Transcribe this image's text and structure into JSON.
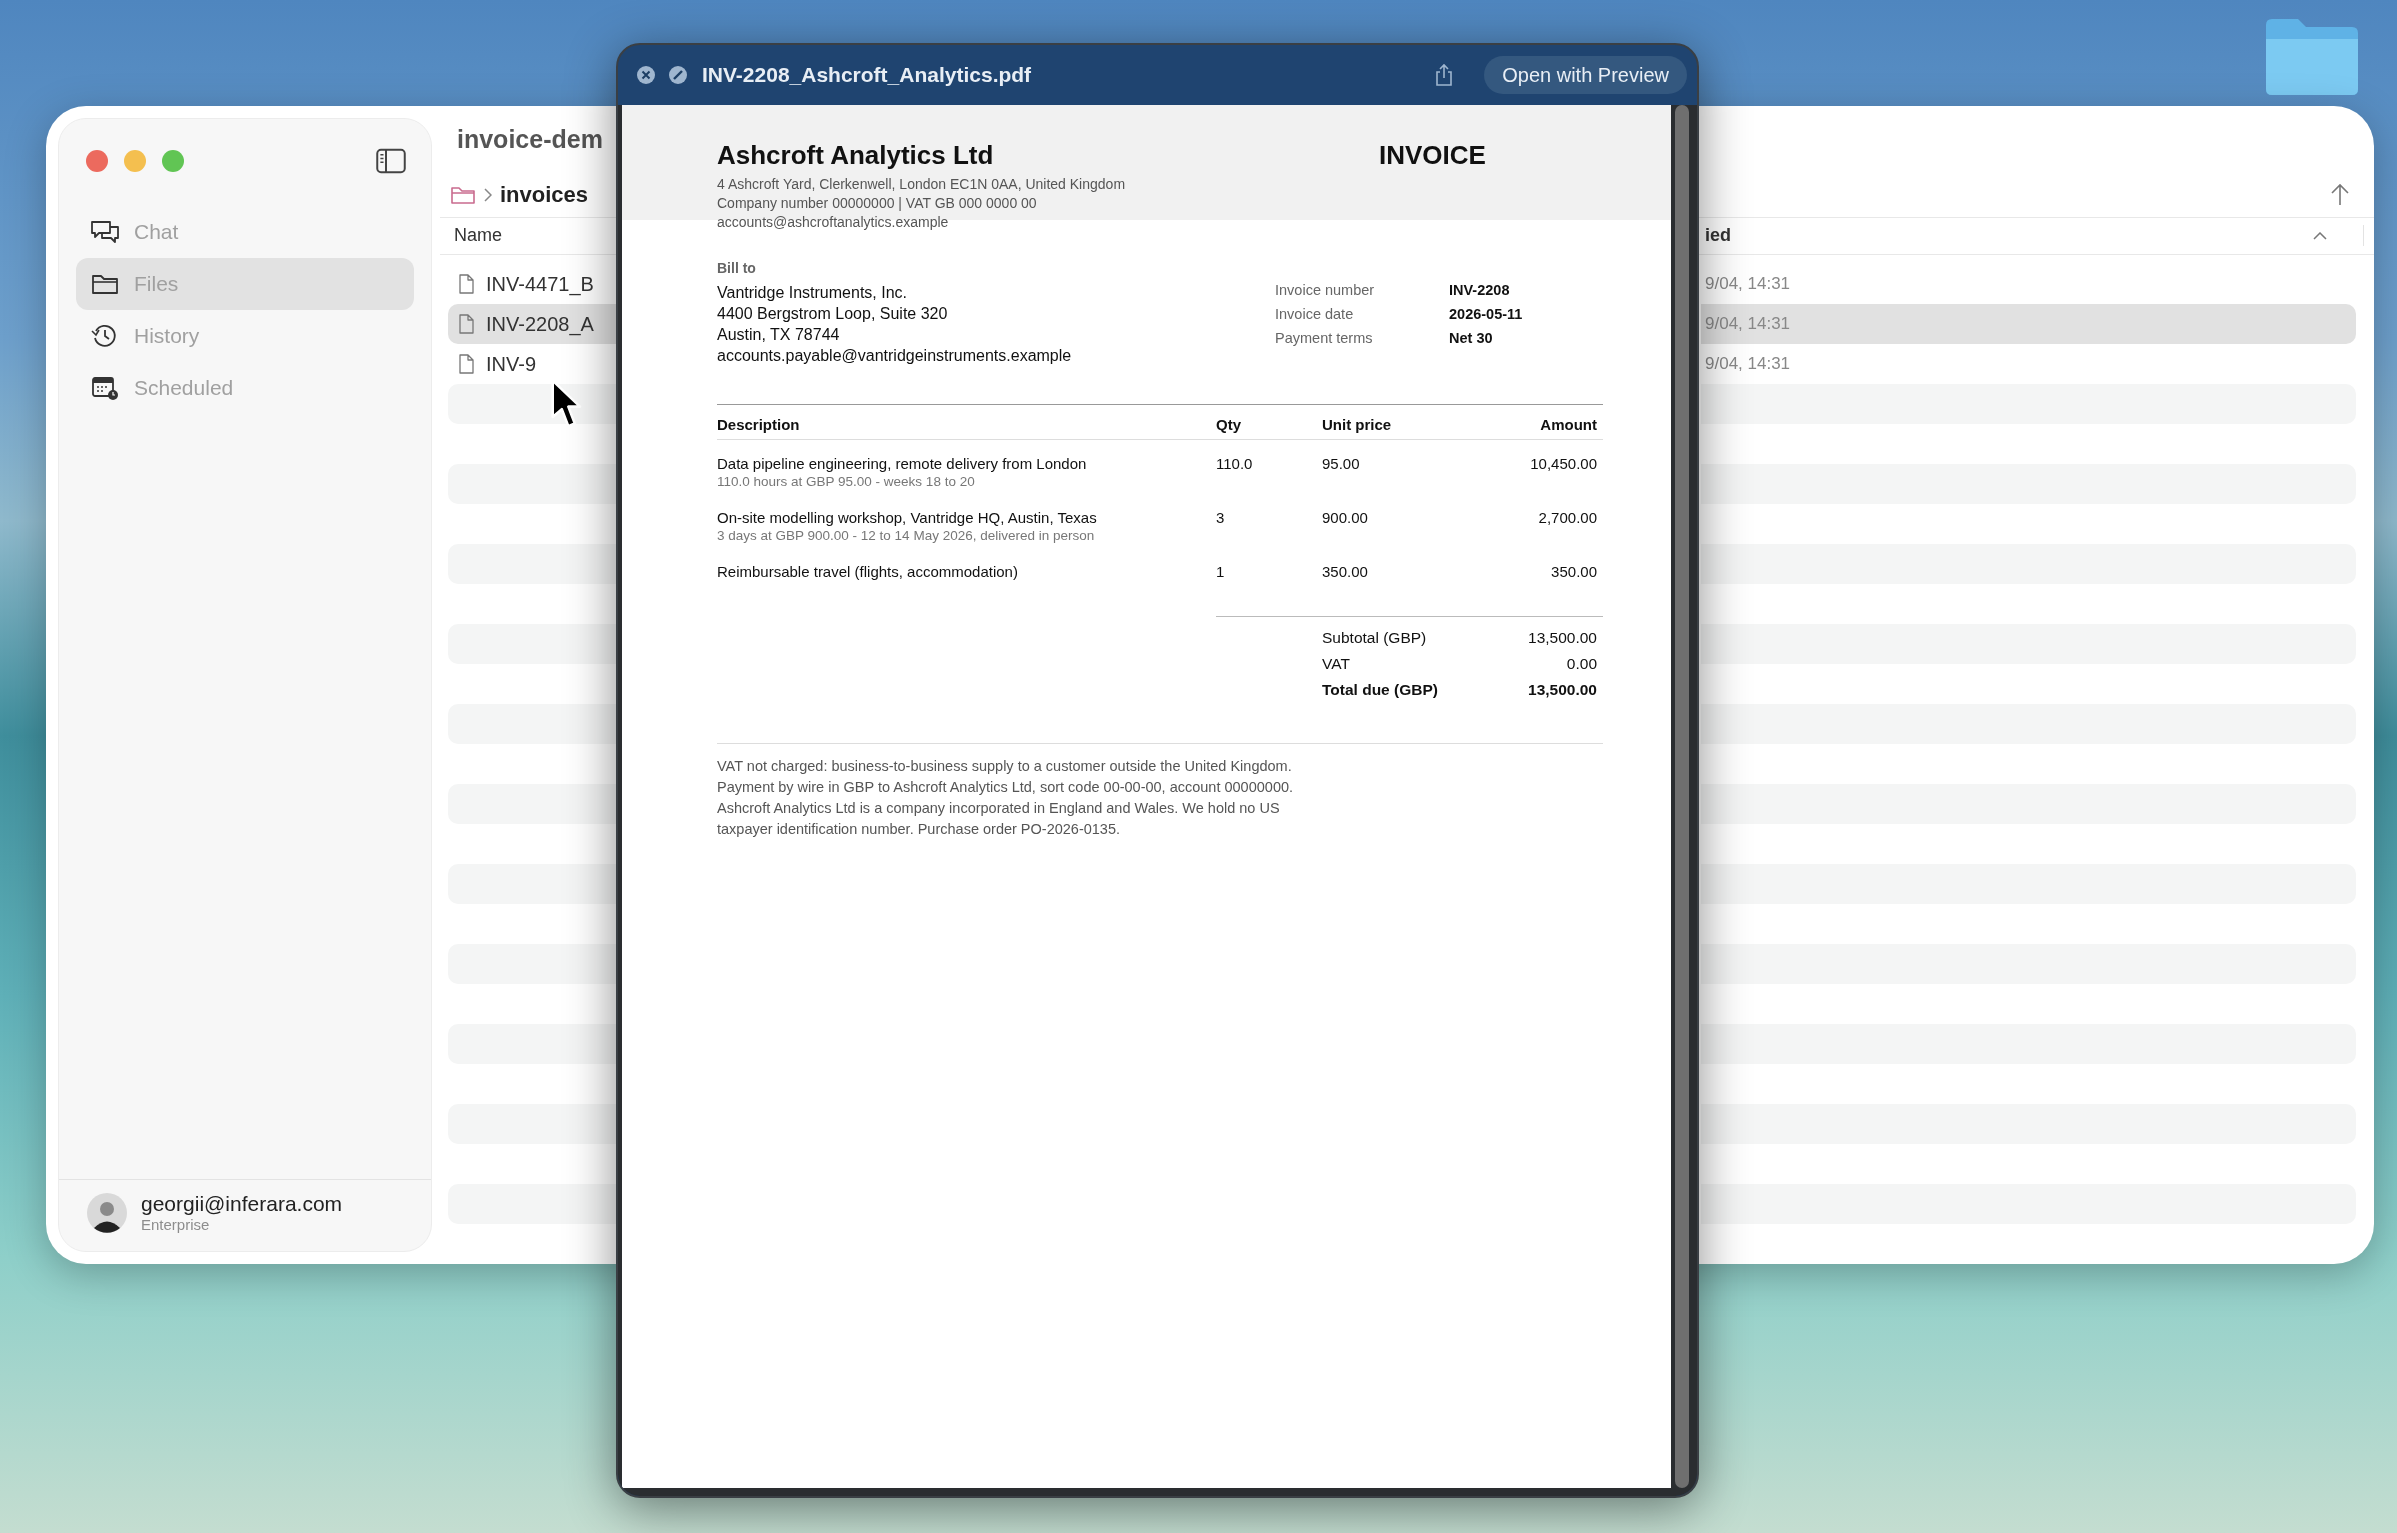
{
  "window": {
    "title": "invoice-dem"
  },
  "sidebar": {
    "items": [
      {
        "label": "Chat",
        "kind": "chat",
        "selected": false
      },
      {
        "label": "Files",
        "kind": "files",
        "selected": true
      },
      {
        "label": "History",
        "kind": "history",
        "selected": false
      },
      {
        "label": "Scheduled",
        "kind": "scheduled",
        "selected": false
      }
    ],
    "user": {
      "email": "georgii@inferara.com",
      "plan": "Enterprise"
    }
  },
  "breadcrumb": {
    "current": "invoices"
  },
  "file_list": {
    "columns": [
      "Name",
      "ied"
    ],
    "rows": [
      {
        "name": "INV-4471_B",
        "modified": "9/04, 14:31",
        "selected": false
      },
      {
        "name": "INV-2208_A",
        "modified": "9/04, 14:31",
        "selected": true
      },
      {
        "name": "INV-9",
        "modified": "9/04, 14:31",
        "selected": false
      }
    ]
  },
  "quick_look": {
    "title": "INV-2208_Ashcroft_Analytics.pdf",
    "open_button": "Open with Preview",
    "document": {
      "company": "Ashcroft Analytics Ltd",
      "company_lines": [
        "4 Ashcroft Yard, Clerkenwell, London EC1N 0AA, United Kingdom",
        "Company number 00000000  |  VAT GB 000 0000 00",
        "accounts@ashcroftanalytics.example"
      ],
      "heading": "INVOICE",
      "bill_to_label": "Bill to",
      "bill_to_lines": [
        "Vantridge Instruments, Inc.",
        "4400 Bergstrom Loop, Suite 320",
        "Austin, TX 78744",
        "accounts.payable@vantridgeinstruments.example"
      ],
      "meta": [
        {
          "label": "Invoice number",
          "value": "INV-2208"
        },
        {
          "label": "Invoice date",
          "value": "2026-05-11"
        },
        {
          "label": "Payment terms",
          "value": "Net 30"
        }
      ],
      "columns": [
        "Description",
        "Qty",
        "Unit price",
        "Amount"
      ],
      "items": [
        {
          "description": "Data pipeline engineering, remote delivery from London",
          "detail": "110.0 hours at GBP 95.00 - weeks 18 to 20",
          "qty": "110.0",
          "unit_price": "95.00",
          "amount": "10,450.00"
        },
        {
          "description": "On-site modelling workshop, Vantridge HQ, Austin, Texas",
          "detail": "3 days at GBP 900.00 - 12 to 14 May 2026, delivered in person",
          "qty": "3",
          "unit_price": "900.00",
          "amount": "2,700.00"
        },
        {
          "description": "Reimbursable travel (flights, accommodation)",
          "qty": "1",
          "unit_price": "350.00",
          "amount": "350.00"
        }
      ],
      "totals": [
        {
          "label": "Subtotal (GBP)",
          "value": "13,500.00",
          "emphasis": false
        },
        {
          "label": "VAT",
          "value": "0.00",
          "emphasis": false
        },
        {
          "label": "Total due (GBP)",
          "value": "13,500.00",
          "emphasis": true
        }
      ],
      "notes": [
        "VAT not charged: business-to-business supply to a customer outside the United Kingdom.",
        "Payment by wire in GBP to Ashcroft Analytics Ltd, sort code 00-00-00, account 00000000.",
        "Ashcroft Analytics Ltd is a company incorporated in England and Wales. We hold no US",
        "taxpayer identification number.  Purchase order PO-2026-0135."
      ]
    }
  }
}
